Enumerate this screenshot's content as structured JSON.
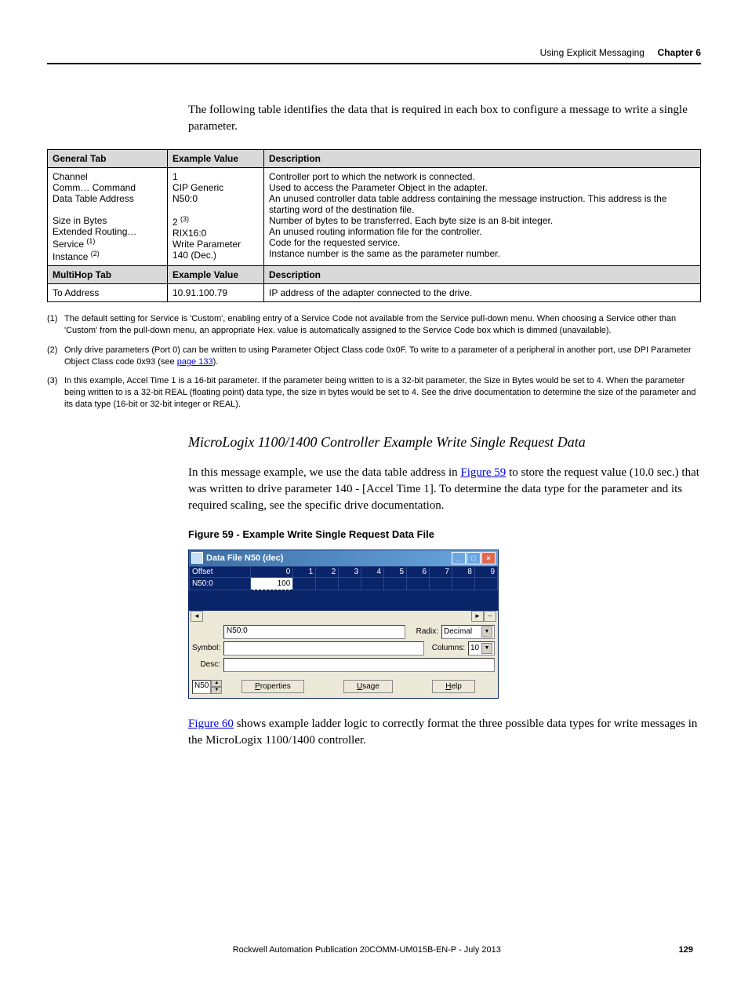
{
  "header": {
    "section": "Using Explicit Messaging",
    "chapter": "Chapter 6"
  },
  "intro": "The following table identifies the data that is required in each box to configure a message to write a single parameter.",
  "table": {
    "headers1": [
      "General Tab",
      "Example Value",
      "Description"
    ],
    "rows1": [
      [
        "Channel",
        "1",
        "Controller port to which the network is connected."
      ],
      [
        "Comm… Command",
        "CIP Generic",
        "Used to access the Parameter Object in the adapter."
      ],
      [
        "Data Table Address",
        "N50:0",
        "An unused controller data table address containing the message instruction. This address is the starting word of the destination file."
      ],
      [
        "Size in Bytes",
        "2 ",
        "Number of bytes to be transferred. Each byte size is an 8-bit integer."
      ],
      [
        "Extended Routing…",
        "RIX16:0",
        "An unused routing information file for the controller."
      ],
      [
        "Service ",
        "Write Parameter",
        "Code for the requested service."
      ],
      [
        "Instance ",
        "140 (Dec.)",
        "Instance number is the same as the parameter number."
      ]
    ],
    "sup_size": "(3)",
    "sup_service": "(1)",
    "sup_instance": "(2)",
    "headers2": [
      "MultiHop Tab",
      "Example Value",
      "Description"
    ],
    "rows2": [
      [
        "To Address",
        "10.91.100.79",
        "IP address of the adapter connected to the drive."
      ]
    ]
  },
  "footnotes": [
    {
      "num": "(1)",
      "text": "The default setting for Service is 'Custom', enabling entry of a Service Code not available from the Service pull-down menu. When choosing a Service other than 'Custom' from the pull-down menu, an appropriate Hex. value is automatically assigned to the Service Code box which is dimmed (unavailable)."
    },
    {
      "num": "(2)",
      "text": "Only drive parameters (Port 0) can be written to using Parameter Object Class code 0x0F. To write to a parameter of a peripheral in another port, use DPI Parameter Object Class code 0x93 (see ",
      "link": "page 133",
      "after": ")."
    },
    {
      "num": "(3)",
      "text": "In this example, Accel Time 1 is a 16-bit parameter. If the parameter being written to is a 32-bit parameter, the Size in Bytes would be set to 4. When the parameter being written to is a 32-bit REAL (floating point) data type, the size in bytes would be set to 4. See the drive documentation to determine the size of the parameter and its data type (16-bit or 32-bit integer or REAL)."
    }
  ],
  "section_heading": "MicroLogix 1100/1400 Controller Example Write Single Request Data",
  "para2_a": "In this message example, we use the data table address in ",
  "para2_link": "Figure 59",
  "para2_b": " to store the request value (10.0 sec.) that was written to drive parameter 140 - [Accel Time 1]. To determine the data type for the parameter and its required scaling, see the specific drive documentation.",
  "figure_caption": "Figure 59 - Example Write Single Request Data File",
  "datafile": {
    "title": "Data File N50 (dec)",
    "cols": [
      "Offset",
      "0",
      "1",
      "2",
      "3",
      "4",
      "5",
      "6",
      "7",
      "8",
      "9"
    ],
    "row_label": "N50:0",
    "row_val0": "100",
    "addr_input": "N50:0",
    "radix_label": "Radix:",
    "radix_value": "Decimal",
    "symbol_label": "Symbol:",
    "columns_label": "Columns:",
    "columns_value": "10",
    "desc_label": "Desc:",
    "file_value": "N50",
    "btn_properties": "Properties",
    "btn_usage": "Usage",
    "btn_help": "Help"
  },
  "para3_a": "",
  "para3_link": "Figure 60",
  "para3_b": " shows example ladder logic to correctly format the three possible data types for write messages in the MicroLogix 1100/1400 controller.",
  "footer": {
    "pub": "Rockwell Automation Publication  20COMM-UM015B-EN-P - July 2013",
    "page": "129"
  }
}
